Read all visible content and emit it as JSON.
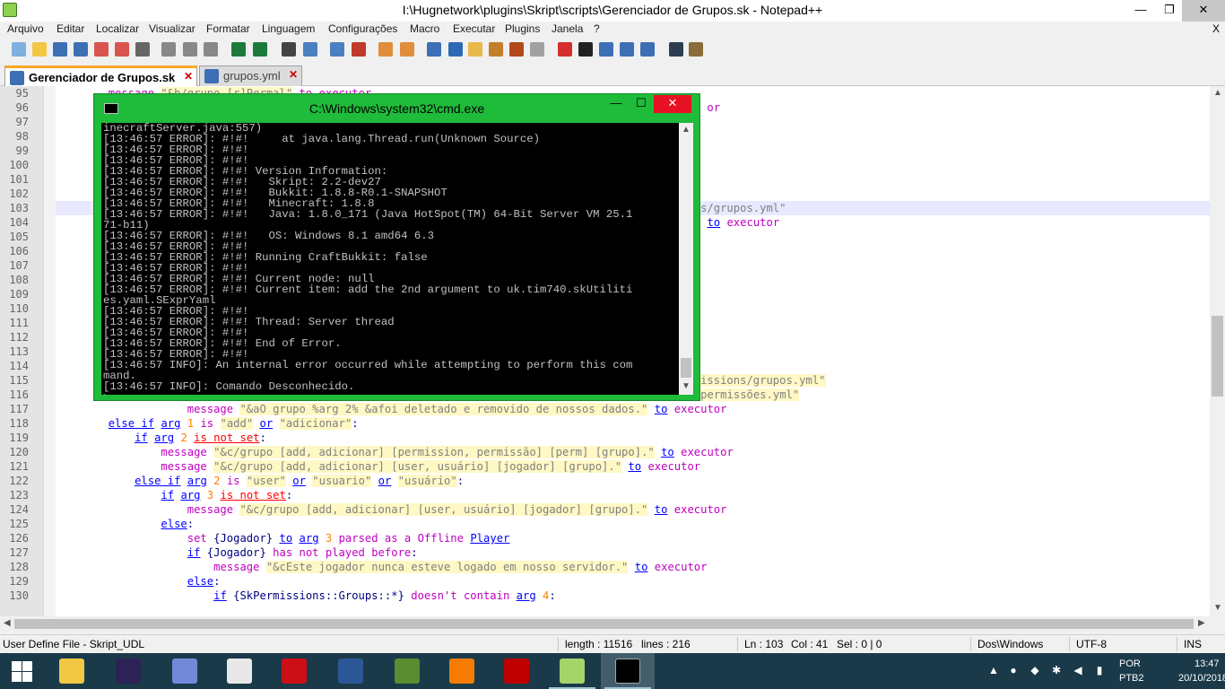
{
  "window": {
    "title": "I:\\Hugnetwork\\plugins\\Skript\\scripts\\Gerenciador de Grupos.sk - Notepad++",
    "min": "—",
    "max": "❐",
    "close": "✕"
  },
  "menu": [
    "Arquivo",
    "Editar",
    "Localizar",
    "Visualizar",
    "Formatar",
    "Linguagem",
    "Configurações",
    "Macro",
    "Executar",
    "Plugins",
    "Janela",
    "?"
  ],
  "menu_close": "X",
  "toolbar_icons": [
    "new-file-icon",
    "open-file-icon",
    "save-icon",
    "save-all-icon",
    "close-icon",
    "close-all-icon",
    "print-icon",
    "cut-icon",
    "copy-icon",
    "paste-icon",
    "undo-icon",
    "redo-icon",
    "find-icon",
    "replace-icon",
    "zoom-in-icon",
    "zoom-out-icon",
    "sync-v-icon",
    "sync-h-icon",
    "word-wrap-icon",
    "show-all-icon",
    "indent-guide-icon",
    "udl-icon",
    "doc-map-icon",
    "function-list-icon",
    "record-icon",
    "stop-icon",
    "play-icon",
    "play-multi-icon",
    "save-macro-icon",
    "spellcheck-icon",
    "plugin-icon"
  ],
  "tabs": [
    {
      "label": "Gerenciador de Grupos.sk",
      "close": "✕"
    },
    {
      "label": "grupos.yml",
      "close": "✕"
    }
  ],
  "editor": {
    "current_line": "103",
    "lines": [
      {
        "n": "95",
        "indent": "        ",
        "html": "<span class='pur'>message</span> <span class='str'>\"&amp;b/grupo [r]Permal\"</span> <span class='pur'>to</span> <span class='pur'>executor</span>"
      },
      {
        "n": "96",
        "indent": "",
        "html": "                                                                                                   <span class='pur'>or</span>"
      },
      {
        "n": "97",
        "indent": "",
        "html": ""
      },
      {
        "n": "98",
        "indent": "",
        "html": ""
      },
      {
        "n": "99",
        "indent": "",
        "html": ""
      },
      {
        "n": "100",
        "indent": "",
        "html": ""
      },
      {
        "n": "101",
        "indent": "",
        "html": ""
      },
      {
        "n": "102",
        "indent": "",
        "html": ""
      },
      {
        "n": "103",
        "indent": "",
        "html": "                                                                                                <span class='str-inner'>ons/grupos.yml\"</span>"
      },
      {
        "n": "104",
        "indent": "",
        "html": "                                                                                                 <span class='str'>\"</span> <span class='kw'>to</span> <span class='pur'>executor</span>"
      },
      {
        "n": "105",
        "indent": "",
        "html": ""
      },
      {
        "n": "106",
        "indent": "",
        "html": ""
      },
      {
        "n": "107",
        "indent": "",
        "html": ""
      },
      {
        "n": "108",
        "indent": "",
        "html": ""
      },
      {
        "n": "109",
        "indent": "",
        "html": ""
      },
      {
        "n": "110",
        "indent": "",
        "html": ""
      },
      {
        "n": "111",
        "indent": "",
        "html": ""
      },
      {
        "n": "112",
        "indent": "",
        "html": ""
      },
      {
        "n": "113",
        "indent": "",
        "html": ""
      },
      {
        "n": "114",
        "indent": "",
        "html": ""
      },
      {
        "n": "115",
        "indent": "",
        "html": "                                                                                                 <span class='str'>missions/grupos.yml\"</span>"
      },
      {
        "n": "116",
        "indent": "",
        "html": "                    <span class='pur'>remove</span> <span class='kw'>arg</span> <span class='or'>2</span> <span class='pur'>from</span> <span class='pur'>skutil yaml nodes</span> <span class='str'>\"Grupos\"</span> <span class='pur'>from file</span> <span class='str'>\"plugins/SkPermissions/permissões.yml\"</span>"
      },
      {
        "n": "117",
        "indent": "",
        "html": "                    <span class='pur'>message</span> <span class='str'>\"&amp;aO grupo %arg 2% &amp;afoi deletado e removido de nossos dados.\"</span> <span class='kw'>to</span> <span class='pur'>executor</span>"
      },
      {
        "n": "118",
        "indent": "",
        "html": "        <span class='kw'>else if</span> <span class='kw'>arg</span> <span class='or'>1</span> <span class='pur'>is</span> <span class='str'>\"add\"</span> <span class='kw'>or</span> <span class='str'>\"adicionar\"</span>:"
      },
      {
        "n": "119",
        "indent": "",
        "html": "            <span class='kw'>if</span> <span class='kw'>arg</span> <span class='or'>2</span> <span class='red'>is not set</span>:"
      },
      {
        "n": "120",
        "indent": "",
        "html": "                <span class='pur'>message</span> <span class='str'>\"&amp;c/grupo [add, adicionar] [permission, permissão] [perm] [grupo].\"</span> <span class='kw'>to</span> <span class='pur'>executor</span>"
      },
      {
        "n": "121",
        "indent": "",
        "html": "                <span class='pur'>message</span> <span class='str'>\"&amp;c/grupo [add, adicionar] [user, usuário] [jogador] [grupo].\"</span> <span class='kw'>to</span> <span class='pur'>executor</span>"
      },
      {
        "n": "122",
        "indent": "",
        "html": "            <span class='kw'>else if</span> <span class='kw'>arg</span> <span class='or'>2</span> <span class='pur'>is</span> <span class='str'>\"user\"</span> <span class='kw'>or</span> <span class='str'>\"usuario\"</span> <span class='kw'>or</span> <span class='str'>\"usuário\"</span>:"
      },
      {
        "n": "123",
        "indent": "",
        "html": "                <span class='kw'>if</span> <span class='kw'>arg</span> <span class='or'>3</span> <span class='red'>is not set</span>:"
      },
      {
        "n": "124",
        "indent": "",
        "html": "                    <span class='pur'>message</span> <span class='str'>\"&amp;c/grupo [add, adicionar] [user, usuário] [jogador] [grupo].\"</span> <span class='kw'>to</span> <span class='pur'>executor</span>"
      },
      {
        "n": "125",
        "indent": "",
        "html": "                <span class='kw'>else</span>:"
      },
      {
        "n": "126",
        "indent": "",
        "html": "                    <span class='pur'>set</span> {Jogador} <span class='kw'>to</span> <span class='kw'>arg</span> <span class='or'>3</span> <span class='pur'>parsed as a</span> <span class='pur'>Offline</span> <span class='kw'>Player</span>"
      },
      {
        "n": "127",
        "indent": "",
        "html": "                    <span class='kw'>if</span> {Jogador} <span class='pur'>has not played before</span>:"
      },
      {
        "n": "128",
        "indent": "",
        "html": "                        <span class='pur'>message</span> <span class='str'>\"&amp;cEste jogador nunca esteve logado em nosso servidor.\"</span> <span class='kw'>to</span> <span class='pur'>executor</span>"
      },
      {
        "n": "129",
        "indent": "",
        "html": "                    <span class='kw'>else</span>:"
      },
      {
        "n": "130",
        "indent": "",
        "html": "                        <span class='kw'>if</span> {SkPermissions::Groups::*} <span class='pur'>doesn't contain</span> <span class='kw'>arg</span> <span class='or'>4</span>:"
      }
    ]
  },
  "status": {
    "lang": "User Define File - Skript_UDL",
    "length": "length : 11516",
    "lines": "lines : 216",
    "ln": "Ln : 103",
    "col": "Col : 41",
    "sel": "Sel : 0 | 0",
    "eol": "Dos\\Windows",
    "encoding": "UTF-8",
    "mode": "INS"
  },
  "cmd": {
    "title": "C:\\Windows\\system32\\cmd.exe",
    "min": "—",
    "max": "☐",
    "close": "✕",
    "lines": [
      "inecraftServer.java:557)",
      "[13:46:57 ERROR]: #!#!     at java.lang.Thread.run(Unknown Source)",
      "[13:46:57 ERROR]: #!#!",
      "[13:46:57 ERROR]: #!#!",
      "[13:46:57 ERROR]: #!#! Version Information:",
      "[13:46:57 ERROR]: #!#!   Skript: 2.2-dev27",
      "[13:46:57 ERROR]: #!#!   Bukkit: 1.8.8-R0.1-SNAPSHOT",
      "[13:46:57 ERROR]: #!#!   Minecraft: 1.8.8",
      "[13:46:57 ERROR]: #!#!   Java: 1.8.0_171 (Java HotSpot(TM) 64-Bit Server VM 25.1",
      "71-b11)",
      "[13:46:57 ERROR]: #!#!   OS: Windows 8.1 amd64 6.3",
      "[13:46:57 ERROR]: #!#!",
      "[13:46:57 ERROR]: #!#! Running CraftBukkit: false",
      "[13:46:57 ERROR]: #!#!",
      "[13:46:57 ERROR]: #!#! Current node: null",
      "[13:46:57 ERROR]: #!#! Current item: add the 2nd argument to uk.tim740.skUtiliti",
      "es.yaml.SExprYaml",
      "[13:46:57 ERROR]: #!#!",
      "[13:46:57 ERROR]: #!#! Thread: Server thread",
      "[13:46:57 ERROR]: #!#!",
      "[13:46:57 ERROR]: #!#! End of Error.",
      "[13:46:57 ERROR]: #!#!",
      "[13:46:57 INFO]: An internal error occurred while attempting to perform this com",
      "mand.",
      "[13:46:57 INFO]: Comando Desconhecido.",
      ">"
    ]
  },
  "taskbar": {
    "apps": [
      {
        "name": "file-explorer",
        "color": "#f2c744"
      },
      {
        "name": "eclipse",
        "color": "#2c2255"
      },
      {
        "name": "discord",
        "color": "#7289da"
      },
      {
        "name": "paint",
        "color": "#e8e8e8"
      },
      {
        "name": "opera",
        "color": "#cc0f16"
      },
      {
        "name": "word",
        "color": "#2b5797"
      },
      {
        "name": "minecraft",
        "color": "#5b8c32"
      },
      {
        "name": "sublime-text",
        "color": "#f57c00"
      },
      {
        "name": "filezilla",
        "color": "#bf0000"
      },
      {
        "name": "notepad-plus-plus",
        "color": "#a4d46a"
      },
      {
        "name": "command-prompt",
        "color": "#000000"
      }
    ],
    "lang_1": "POR",
    "lang_2": "PTB2",
    "time": "13:47",
    "date": "20/10/2018"
  }
}
